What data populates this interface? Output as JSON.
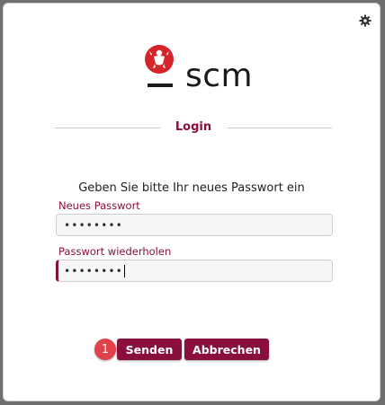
{
  "header": {
    "settings_icon": "gear-icon",
    "logo_text": "scm",
    "logo_icon": "lion-emblem-icon"
  },
  "login": {
    "title": "Login",
    "prompt": "Geben Sie bitte Ihr neues Passwort ein",
    "new_password_label": "Neues Passwort",
    "new_password_value": "••••••••",
    "repeat_password_label": "Passwort wiederholen",
    "repeat_password_value": "••••••••"
  },
  "actions": {
    "step_badge": "1",
    "send_label": "Senden",
    "cancel_label": "Abbrechen"
  },
  "colors": {
    "accent": "#8a0f3e",
    "logo_red": "#d6242b",
    "badge_red": "#e0414b"
  }
}
